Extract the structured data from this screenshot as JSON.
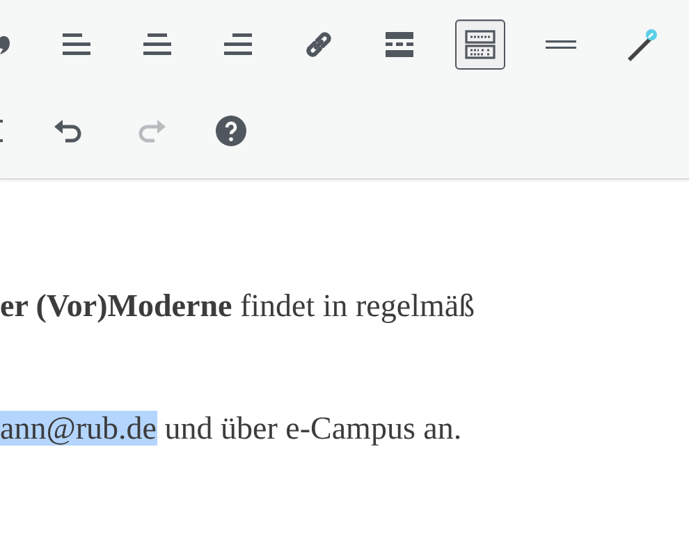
{
  "toolbar": {
    "rows": [
      [
        {
          "kind": "quote",
          "active": false,
          "disabled": false
        },
        {
          "kind": "align-left",
          "active": false,
          "disabled": false
        },
        {
          "kind": "align-center",
          "active": false,
          "disabled": false
        },
        {
          "kind": "align-right",
          "active": false,
          "disabled": false
        },
        {
          "kind": "link",
          "active": false,
          "disabled": false
        },
        {
          "kind": "read-more",
          "active": false,
          "disabled": false
        },
        {
          "kind": "toolbar-toggle",
          "active": true,
          "disabled": false
        },
        {
          "kind": "horizontal-line",
          "active": false,
          "disabled": false
        },
        {
          "kind": "wand",
          "active": false,
          "disabled": false
        }
      ],
      [
        {
          "kind": "indent",
          "active": false,
          "disabled": false
        },
        {
          "kind": "undo",
          "active": false,
          "disabled": false
        },
        {
          "kind": "redo",
          "active": false,
          "disabled": true
        },
        {
          "kind": "help",
          "active": false,
          "disabled": false
        }
      ]
    ]
  },
  "content": {
    "paragraphs": [
      {
        "segments": [
          {
            "text": "**er (Vor)Moderne** findet in regelmäß",
            "selected": false
          }
        ]
      },
      {
        "segments": [
          {
            "text": "ann@rub.de",
            "selected": true
          },
          {
            "text": " und über e-Campus an.",
            "selected": false
          }
        ]
      }
    ]
  }
}
